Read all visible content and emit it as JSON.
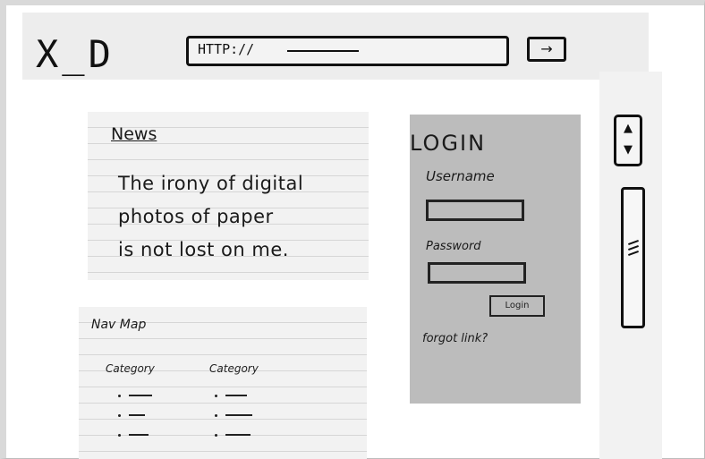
{
  "window": {
    "controls": "X_D",
    "url": "HTTP://",
    "go_icon": "arrow-right-icon"
  },
  "news": {
    "title": "News",
    "body": [
      "The irony of digital",
      "photos of paper",
      "is not lost on me."
    ]
  },
  "navmap": {
    "title": "Nav Map",
    "categories": [
      {
        "label": "Category",
        "items": 3
      },
      {
        "label": "Category",
        "items": 3
      }
    ]
  },
  "login": {
    "title": "LOGIN",
    "username_label": "Username",
    "password_label": "Password",
    "button_label": "Login",
    "forgot_link": "forgot link?"
  },
  "scroll": {
    "up_icon": "triangle-up-icon",
    "down_icon": "triangle-down-icon"
  },
  "colors": {
    "ink": "#111111",
    "paper": "#f2f2f2",
    "login_panel": "#bcbcbc"
  }
}
